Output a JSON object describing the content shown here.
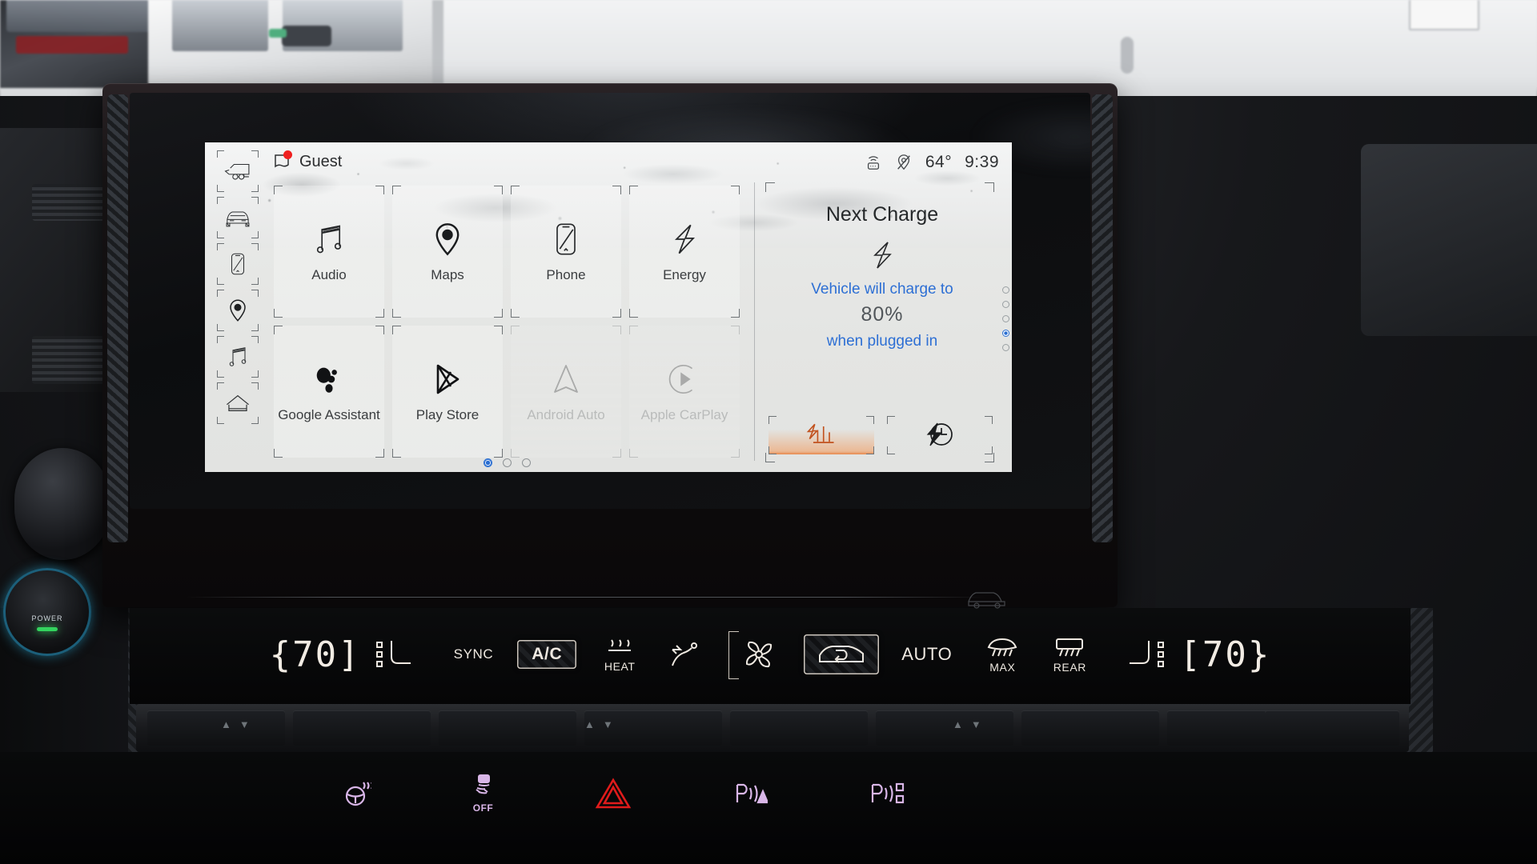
{
  "status_bar": {
    "wifi_icon": "hotspot-icon",
    "location_icon": "location-off-icon",
    "temperature": "64°",
    "time": "9:39"
  },
  "profile": {
    "name": "Guest",
    "icon": "profile-tag-icon",
    "badge": "notification-dot"
  },
  "sidebar": {
    "items": [
      {
        "name": "trailer",
        "icon": "trailer-icon"
      },
      {
        "name": "vehicle",
        "icon": "vehicle-front-icon"
      },
      {
        "name": "phone",
        "icon": "phone-icon"
      },
      {
        "name": "navigation",
        "icon": "location-pin-icon"
      },
      {
        "name": "audio",
        "icon": "music-note-icon"
      },
      {
        "name": "home",
        "icon": "home-icon"
      }
    ]
  },
  "apps": [
    {
      "label": "Audio",
      "icon": "music-note-icon",
      "enabled": true
    },
    {
      "label": "Maps",
      "icon": "location-pin-icon",
      "enabled": true
    },
    {
      "label": "Phone",
      "icon": "phone-icon",
      "enabled": true
    },
    {
      "label": "Energy",
      "icon": "lightning-bolt-icon",
      "enabled": true
    },
    {
      "label": "Google Assistant",
      "icon": "google-assistant-icon",
      "enabled": true
    },
    {
      "label": "Play Store",
      "icon": "play-store-icon",
      "enabled": true
    },
    {
      "label": "Android Auto",
      "icon": "android-auto-icon",
      "enabled": false
    },
    {
      "label": "Apple CarPlay",
      "icon": "apple-carplay-icon",
      "enabled": false
    }
  ],
  "page_dots": {
    "count": 3,
    "active_index": 0
  },
  "scroll_dots": {
    "count": 5,
    "active_index": 3
  },
  "widget": {
    "title": "Next Charge",
    "icon": "lightning-bolt-icon",
    "line1": "Vehicle will charge to",
    "value": "80%",
    "line2": "when plugged in",
    "actions": [
      {
        "name": "charge-limit",
        "icon": "charge-levels-icon",
        "active": true
      },
      {
        "name": "scheduled-charging",
        "icon": "charge-clock-icon",
        "active": false
      }
    ]
  },
  "climate": {
    "driver_temp": "70",
    "passenger_temp": "70",
    "sync_label": "SYNC",
    "ac_label": "A/C",
    "heat_label": "HEAT",
    "auto_label": "AUTO",
    "max_label": "MAX",
    "rear_label": "REAR",
    "controls": [
      {
        "name": "driver-temp",
        "icon": "temperature-value"
      },
      {
        "name": "driver-seat-heat",
        "icon": "seat-heat-icon"
      },
      {
        "name": "sync",
        "icon": "sync-text"
      },
      {
        "name": "ac",
        "icon": "ac-text",
        "active": true
      },
      {
        "name": "heated-seat-heat",
        "icon": "heat-waves-icon"
      },
      {
        "name": "airflow-mode",
        "icon": "airflow-icon"
      },
      {
        "name": "fan-speed",
        "icon": "fan-icon"
      },
      {
        "name": "recirculation",
        "icon": "recirculation-icon",
        "active": true
      },
      {
        "name": "auto",
        "icon": "auto-text"
      },
      {
        "name": "front-defrost",
        "icon": "front-defrost-icon"
      },
      {
        "name": "rear-defrost",
        "icon": "rear-defrost-icon"
      },
      {
        "name": "passenger-seat-heat",
        "icon": "seat-heat-icon"
      },
      {
        "name": "passenger-temp",
        "icon": "temperature-value"
      }
    ]
  },
  "hard_buttons": [
    {
      "name": "heated-steering-wheel",
      "icon": "steering-wheel-heat-icon",
      "color": "#d9b6e8",
      "sub": ""
    },
    {
      "name": "traction-control",
      "icon": "traction-control-icon",
      "color": "#d9b6e8",
      "sub": "OFF"
    },
    {
      "name": "hazard-lights",
      "icon": "hazard-triangle-icon",
      "color": "#e01b1b",
      "sub": ""
    },
    {
      "name": "front-park-assist",
      "icon": "park-assist-front-icon",
      "color": "#d9b6e8",
      "sub": ""
    },
    {
      "name": "rear-park-assist",
      "icon": "park-assist-rear-icon",
      "color": "#d9b6e8",
      "sub": ""
    }
  ],
  "power_knob": {
    "label": "POWER",
    "led_color": "#33d45e"
  },
  "colors": {
    "accent_blue": "#2d6fd4",
    "charge_orange": "#e8782f",
    "hazard_red": "#e01b1b",
    "screen_bg": "#e8e9e7"
  }
}
